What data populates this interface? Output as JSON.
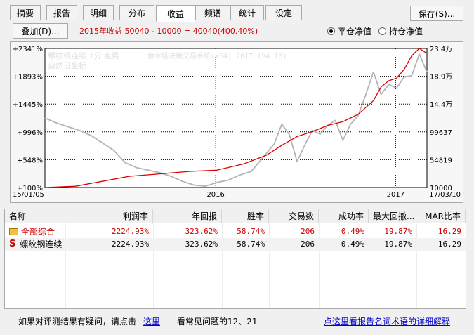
{
  "tabs": [
    "摘要",
    "报告",
    "明细",
    "分布",
    "收益",
    "频谱",
    "统计",
    "设定"
  ],
  "active_tab": 4,
  "save_button": "保存(S)...",
  "overlay_button": "叠加(D)...",
  "summary_text": "2015年收益 50040 - 10000 = 40040(400.40%)",
  "radio": {
    "flat": "平仓净值",
    "hold": "持仓净值",
    "selected": "flat"
  },
  "chart_data": {
    "type": "line",
    "title": "",
    "legend_line1": "螺纹钢连续 1分 走势",
    "legend_line2": "自然日坐标",
    "watermark": "金字塔决策交易系统(x64) 2017 (V4.10)",
    "y_left_ticks": [
      "+2341%",
      "+1893%",
      "+1445%",
      "+996%",
      "+548%",
      "+100%"
    ],
    "y_right_ticks": [
      "23.4万",
      "18.9万",
      "14.4万",
      "99637",
      "54819",
      "10000"
    ],
    "ylim": [
      10000,
      234000
    ],
    "x_ticks": [
      "15/01/05",
      "2016",
      "2017",
      "17/03/10"
    ],
    "series": [
      {
        "color": "#dd0000",
        "x": [
          0.0,
          0.08,
          0.15,
          0.22,
          0.3,
          0.38,
          0.45,
          0.52,
          0.58,
          0.62,
          0.66,
          0.7,
          0.74,
          0.78,
          0.82,
          0.86,
          0.88,
          0.9,
          0.92,
          0.94,
          0.96,
          0.98,
          1.0
        ],
        "values": [
          10000,
          12000,
          20000,
          28000,
          32000,
          36000,
          38000,
          48000,
          62000,
          78000,
          92000,
          100000,
          110000,
          116000,
          128000,
          150000,
          172000,
          182000,
          186000,
          200000,
          222000,
          234000,
          226000
        ]
      },
      {
        "color": "#b4b4b4",
        "x": [
          0.0,
          0.03,
          0.06,
          0.09,
          0.12,
          0.15,
          0.18,
          0.21,
          0.24,
          0.27,
          0.3,
          0.33,
          0.36,
          0.39,
          0.42,
          0.45,
          0.48,
          0.51,
          0.54,
          0.57,
          0.6,
          0.62,
          0.64,
          0.66,
          0.68,
          0.7,
          0.72,
          0.74,
          0.76,
          0.78,
          0.8,
          0.82,
          0.84,
          0.86,
          0.88,
          0.9,
          0.92,
          0.94,
          0.96,
          0.98,
          1.0
        ],
        "values": [
          122000,
          114000,
          108000,
          102000,
          94000,
          82000,
          70000,
          50000,
          42000,
          38000,
          34000,
          28000,
          20000,
          14000,
          12000,
          18000,
          22000,
          30000,
          36000,
          58000,
          80000,
          112000,
          95000,
          52000,
          78000,
          102000,
          96000,
          110000,
          118000,
          86000,
          112000,
          126000,
          160000,
          196000,
          160000,
          176000,
          170000,
          188000,
          190000,
          225000,
          196000
        ]
      }
    ]
  },
  "table": {
    "headers": [
      "名称",
      "利润率",
      "年回报",
      "胜率",
      "交易数",
      "成功率",
      "最大回撤...",
      "MAR比率"
    ],
    "rows": [
      [
        "全部综合",
        "2224.93%",
        "323.62%",
        "58.74%",
        "206",
        "0.49%",
        "19.87%",
        "16.29"
      ],
      [
        "螺纹钢连续",
        "2224.93%",
        "323.62%",
        "58.74%",
        "206",
        "0.49%",
        "19.87%",
        "16.29"
      ]
    ],
    "row_icons": [
      "folder-icon",
      "s-icon"
    ],
    "s_glyph": "S"
  },
  "footer": {
    "question": "如果对评测结果有疑问，请点击",
    "here": "这里",
    "faq": "看常见问题的12、21",
    "glossary": "点这里看报告名词术语的详细解释"
  }
}
